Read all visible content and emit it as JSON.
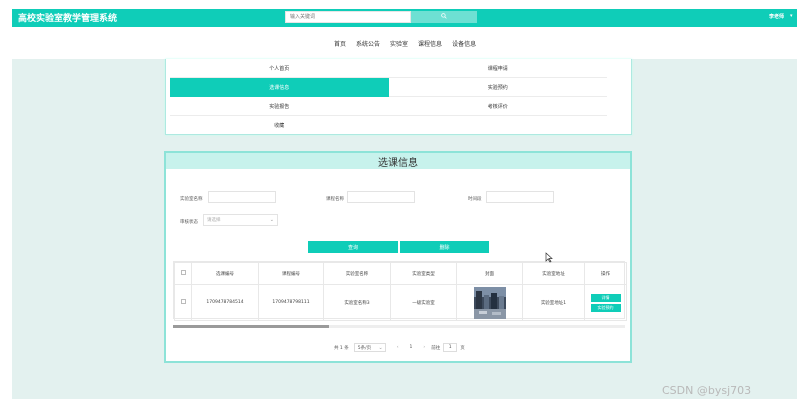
{
  "header": {
    "site_title": "高校实验室教学管理系统",
    "search_placeholder": "输入关键词",
    "search_icon": "search-icon",
    "user_name": "李老师",
    "caret": "▾"
  },
  "nav": {
    "items": [
      "首页",
      "系统公告",
      "实验室",
      "课程信息",
      "设备信息"
    ]
  },
  "user_menu": {
    "rows": [
      [
        "个人首页",
        "课程申请"
      ],
      [
        "选课信息",
        "实验预约"
      ],
      [
        "实验报告",
        "考核评价"
      ],
      [
        "收藏",
        ""
      ]
    ],
    "active": "选课信息"
  },
  "course_selection": {
    "title": "选课信息",
    "filters": {
      "lab_name_label": "实验室名称",
      "course_name_label": "课程名称",
      "time_label": "时间段",
      "audit_status_label": "审核状态",
      "audit_status_value": "请选择"
    },
    "buttons": {
      "search": "查询",
      "delete": "删除"
    },
    "table": {
      "columns": [
        "",
        "选课编号",
        "课程编号",
        "实验室名称",
        "实验室类型",
        "封面",
        "实验室地址",
        "操作"
      ],
      "rows": [
        {
          "selection_no": "1709478784514",
          "course_no": "1709478798111",
          "lab_name": "实验室名称3",
          "lab_type": "一级实验室",
          "cover": "lab-photo",
          "lab_address": "实验室地址1",
          "actions": [
            "详情",
            "实验预约"
          ]
        }
      ]
    },
    "pagination": {
      "total_text": "共 1 条",
      "page_size": "5条/页",
      "prev": "‹",
      "current_page": "1",
      "next": "›",
      "goto_label": "前往",
      "goto_value": "1",
      "page_suffix": "页"
    }
  },
  "watermark": "CSDN @bysj703",
  "colors": {
    "accent": "#0fcdb8",
    "page_bg": "#e3f1ef",
    "card_header": "#c7f2ec"
  }
}
